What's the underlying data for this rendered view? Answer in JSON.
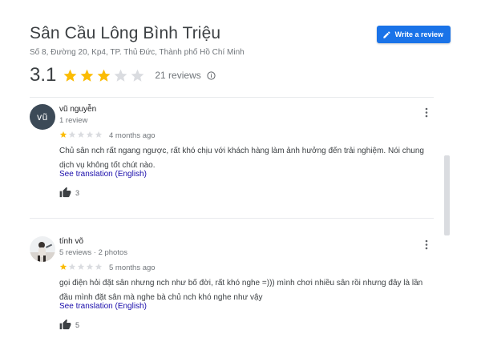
{
  "place": {
    "title": "Sân Cầu Lông Bình Triệu",
    "address": "Số 8, Đường 20, Kp4, TP. Thủ Đức, Thành phố Hồ Chí Minh",
    "write_review_label": "Write a review"
  },
  "summary": {
    "score": "3.1",
    "stars_filled": 3,
    "stars_total": 5,
    "count_label": "21 reviews"
  },
  "reviews": [
    {
      "avatar_text": "vũ",
      "name": "vũ nguyễn",
      "meta": "1 review",
      "rating": 1,
      "date": "4 months ago",
      "text": "Chủ sân nch rất ngang ngược, rất khó chịu với khách hàng làm ảnh hưởng đến trải nghiệm. Nói chung dịch vụ không tốt chút nào.",
      "translation_label": "See translation (English)",
      "likes": "3"
    },
    {
      "avatar_text": "",
      "name": "tính võ",
      "meta": "5 reviews · 2 photos",
      "rating": 1,
      "date": "5 months ago",
      "text": "gọi điện hỏi đặt sân nhưng nch như bố đời, rất khó nghe =))) mình chơi nhiều sân rồi nhưng đây là lần đầu mình đặt sân mà nghe bà chủ nch khó nghe như vậy",
      "translation_label": "See translation (English)",
      "likes": "5"
    }
  ],
  "colors": {
    "star_filled": "#fbbc04",
    "star_empty": "#dadce0",
    "accent": "#1a73e8",
    "link": "#1a0dab"
  },
  "icons": {
    "write": "pencil-icon",
    "info": "info-icon",
    "more": "more-vert-icon",
    "like": "thumb-up-icon"
  }
}
